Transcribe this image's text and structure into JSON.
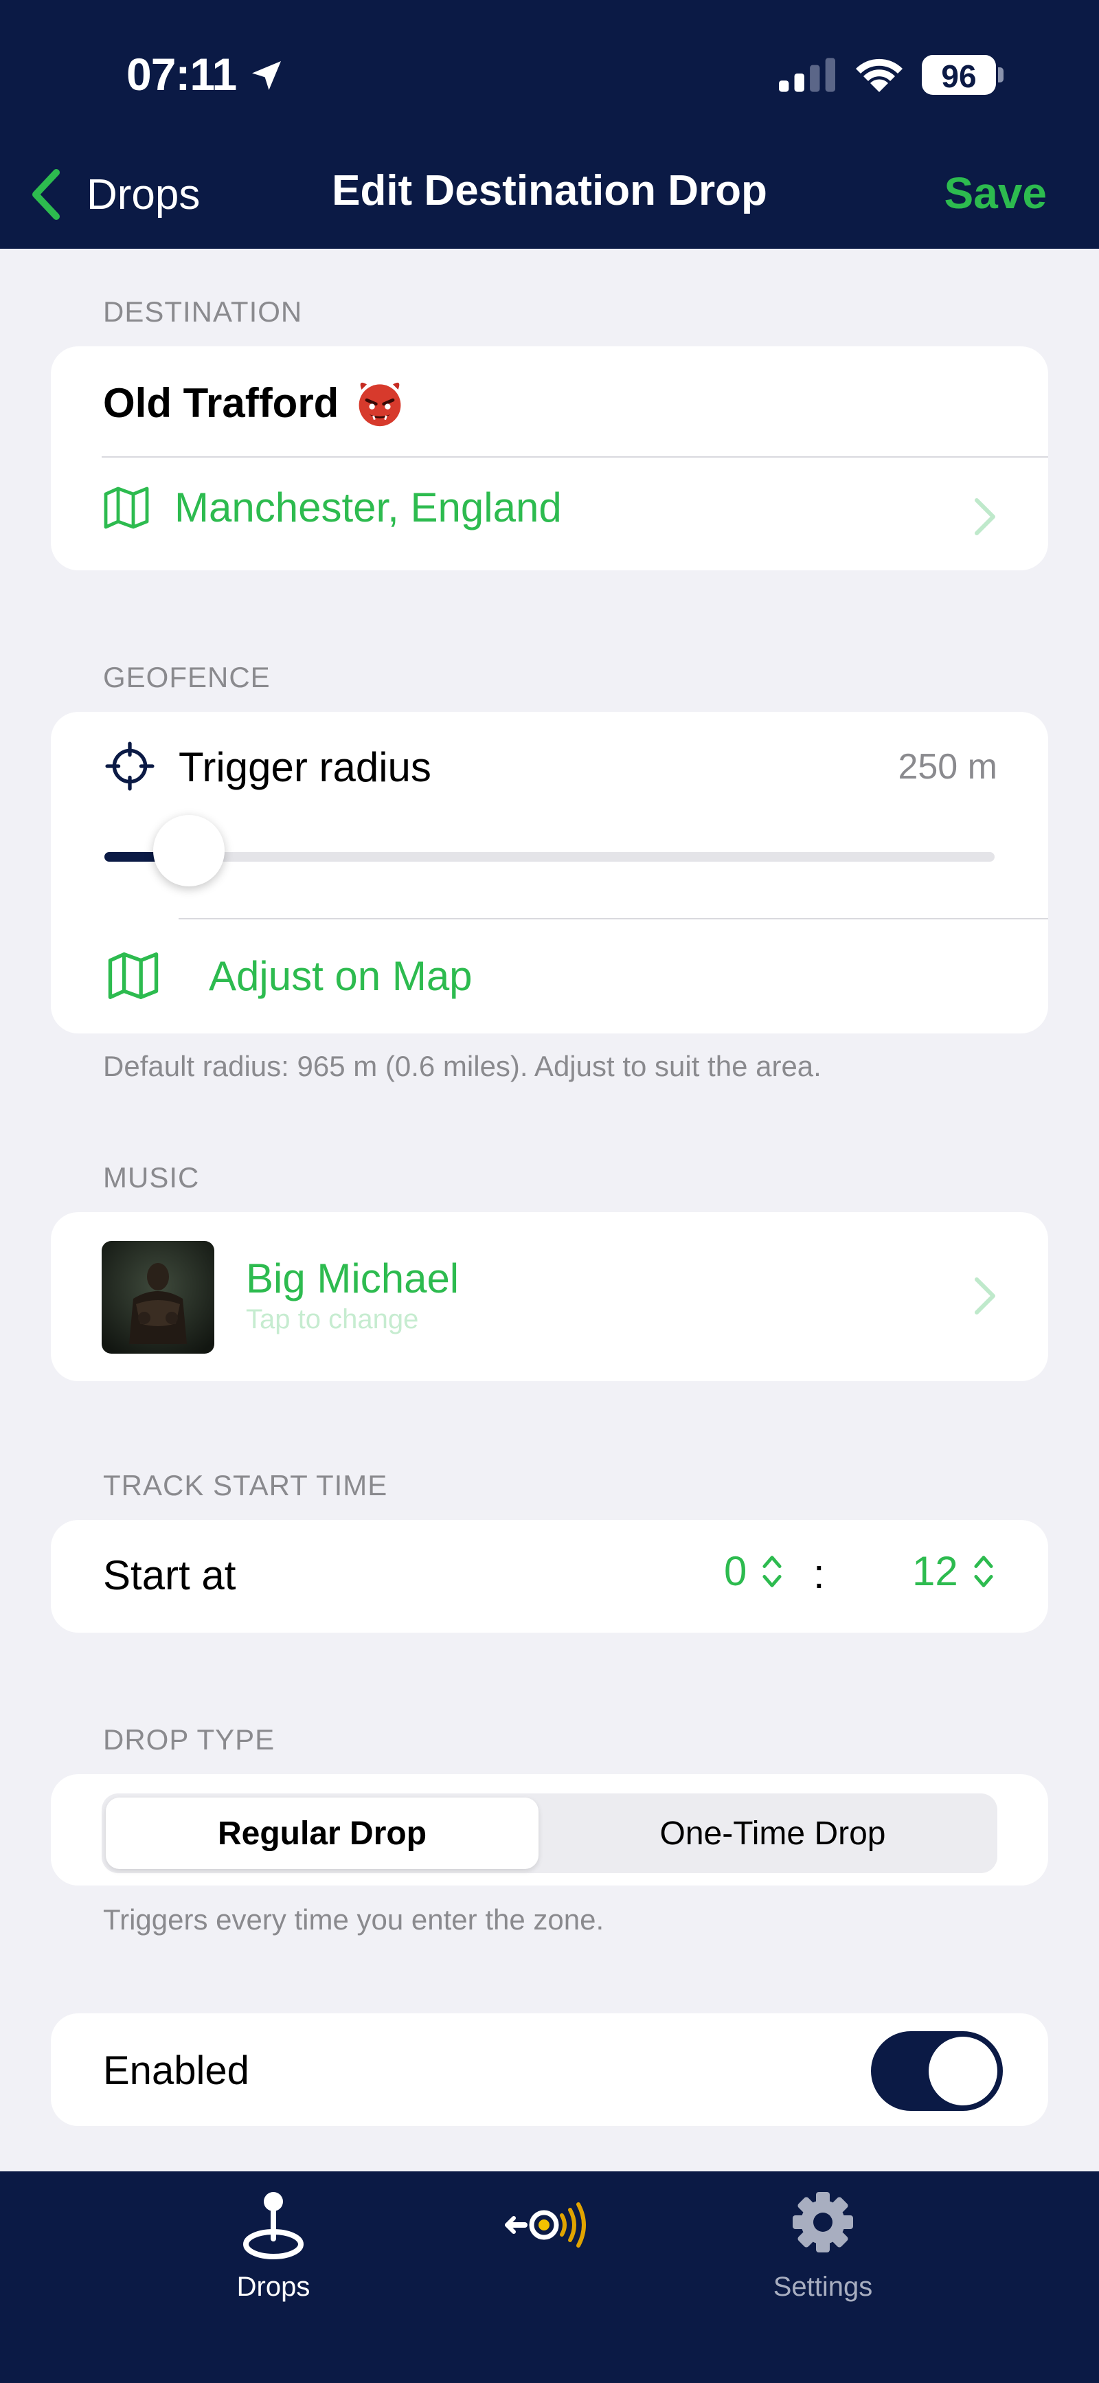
{
  "status_bar": {
    "time": "07:11",
    "battery": "96"
  },
  "nav": {
    "back_label": "Drops",
    "title": "Edit Destination Drop",
    "save_label": "Save"
  },
  "destination": {
    "header": "DESTINATION",
    "name": "Old Trafford",
    "location": "Manchester, England"
  },
  "geofence": {
    "header": "GEOFENCE",
    "trigger_label": "Trigger radius",
    "trigger_value": "250 m",
    "slider_fraction": 0.07,
    "adjust_label": "Adjust on Map",
    "note": "Default radius: 965 m (0.6 miles). Adjust to suit the area."
  },
  "music": {
    "header": "MUSIC",
    "track_title": "Big Michael",
    "subtitle": "Tap to change"
  },
  "track_start": {
    "header": "TRACK START TIME",
    "label": "Start at",
    "minutes": "0",
    "separator": ":",
    "seconds": "12"
  },
  "drop_type": {
    "header": "DROP TYPE",
    "options": [
      "Regular Drop",
      "One-Time Drop"
    ],
    "selected": "Regular Drop",
    "note": "Triggers every time you enter the zone."
  },
  "enabled": {
    "label": "Enabled",
    "on": true
  },
  "tabbar": {
    "items": [
      {
        "label": "Drops",
        "icon": "pin-drop-icon",
        "active": true
      },
      {
        "label": "",
        "icon": "radar-logo-icon",
        "active": false
      },
      {
        "label": "Settings",
        "icon": "gear-icon",
        "active": false
      }
    ]
  },
  "colors": {
    "navy": "#0b1a45",
    "accent_green": "#2dbb4f",
    "secondary_text": "#8a8a8e",
    "background": "#f1f1f6"
  }
}
